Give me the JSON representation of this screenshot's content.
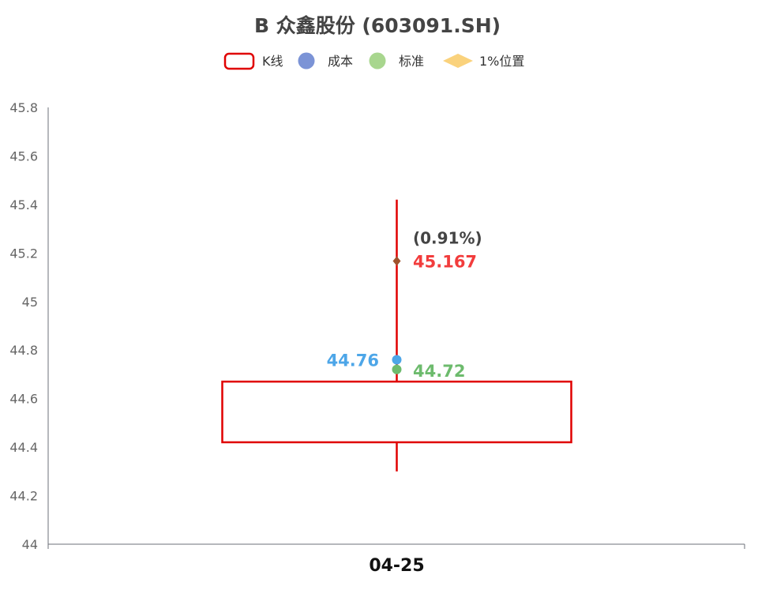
{
  "chart_data": {
    "type": "candlestick",
    "title": "B 众鑫股份 (603091.SH)",
    "legend": {
      "placement": "top-center",
      "items": [
        {
          "label": "K线",
          "shape": "rounded-rect-outline",
          "color": "#e00000"
        },
        {
          "label": "成本",
          "shape": "circle",
          "color": "#7b93d6"
        },
        {
          "label": "标准",
          "shape": "circle",
          "color": "#a8d68e"
        },
        {
          "label": "1%位置",
          "shape": "diamond",
          "color": "#fad27c"
        }
      ]
    },
    "categories": [
      "04-25"
    ],
    "y_ticks": [
      "44",
      "44.2",
      "44.4",
      "44.6",
      "44.8",
      "45",
      "45.2",
      "45.4",
      "45.6",
      "45.8"
    ],
    "ylim": [
      44,
      45.8
    ],
    "candle": {
      "open": 44.42,
      "close": 44.67,
      "low": 44.3,
      "high": 45.42,
      "color": "#e00000"
    },
    "points": [
      {
        "name": "成本",
        "value": 44.76,
        "label": "44.76",
        "color": "#4da6e8"
      },
      {
        "name": "标准",
        "value": 44.72,
        "label": "44.72",
        "color": "#6dbb6d"
      },
      {
        "name": "1%位置",
        "value": 45.167,
        "label": "45.167",
        "color": "#f23c3c",
        "marker_color": "#a0522d",
        "note": "(0.91%)"
      }
    ],
    "grid": false
  }
}
